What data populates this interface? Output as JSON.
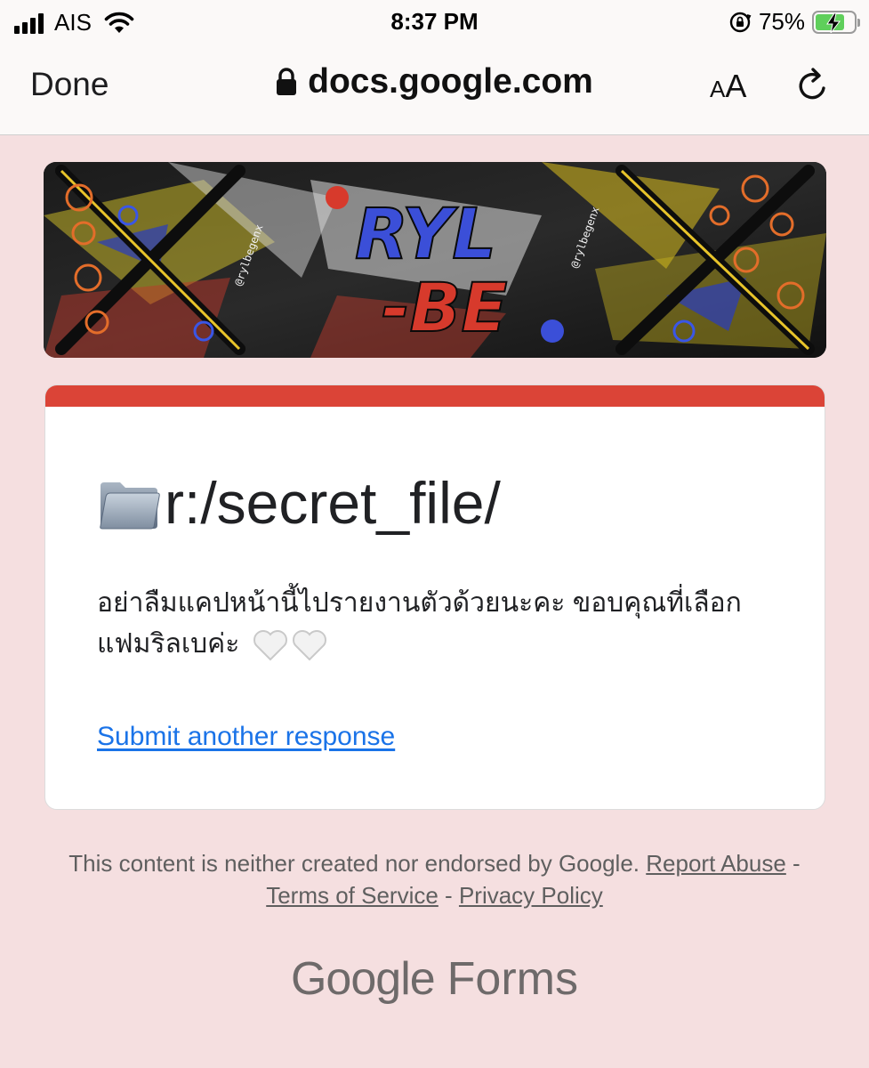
{
  "status_bar": {
    "carrier": "AIS",
    "time": "8:37 PM",
    "battery_percent": "75%",
    "battery_level": 0.75,
    "battery_charging": true,
    "icons": [
      "signal-icon",
      "wifi-icon",
      "orientation-lock-icon",
      "battery-icon"
    ]
  },
  "browser": {
    "done_label": "Done",
    "url": "docs.google.com",
    "text_size_label_small": "A",
    "text_size_label_big": "A",
    "icons": [
      "lock-icon",
      "reload-icon"
    ]
  },
  "banner": {
    "alt": "header image",
    "text_line1": "RYL",
    "text_line2": "-BE",
    "side_text": "@rylbegenx"
  },
  "form": {
    "accent_color": "#db4437",
    "title_icon": "folder-icon",
    "title": "r:/secret_file/",
    "message": "อย่าลืมแคปหน้านี้ไปรายงานตัวด้วยนะคะ ขอบคุณที่เลือกแฟมริลเบค่ะ",
    "message_emoji": "🤍🤍",
    "submit_another": "Submit another response"
  },
  "footer": {
    "disclaimer": "This content is neither created nor endorsed by Google.",
    "report_abuse": "Report Abuse",
    "separator1": " - ",
    "terms": "Terms of Service",
    "separator2": " - ",
    "privacy": "Privacy Policy",
    "brand_google": "Google",
    "brand_forms": "Forms"
  }
}
